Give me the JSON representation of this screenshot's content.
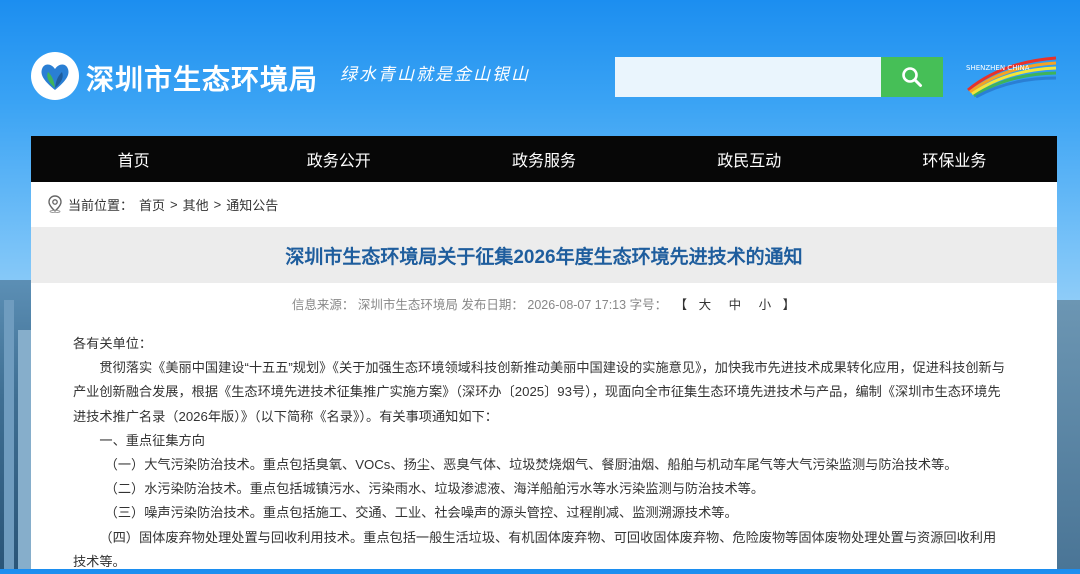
{
  "header": {
    "site_title": "深圳市生态环境局",
    "slogan": "绿水青山就是金山银山",
    "search": {
      "placeholder": ""
    },
    "city_logo_text": "SHENZHEN CHINA"
  },
  "nav": {
    "items": [
      "首页",
      "政务公开",
      "政务服务",
      "政民互动",
      "环保业务"
    ]
  },
  "breadcrumb": {
    "label": "当前位置：",
    "items": [
      "首页",
      "其他",
      "通知公告"
    ],
    "separator": ">"
  },
  "article": {
    "title": "深圳市生态环境局关于征集2026年度生态环境先进技术的通知",
    "meta": {
      "source_label": "信息来源：",
      "source": "深圳市生态环境局",
      "date_label": "发布日期：",
      "date": "2026-08-07 17:13",
      "size_label": "字号：",
      "size_open": "【",
      "sizes": [
        "大",
        "中",
        "小"
      ],
      "size_close": "】"
    },
    "paragraphs": [
      "各有关单位：",
      "贯彻落实《美丽中国建设“十五五”规划》《关于加强生态环境领域科技创新推动美丽中国建设的实施意见》，加快我市先进技术成果转化应用，促进科技创新与产业创新融合发展，根据《生态环境先进技术征集推广实施方案》（深环办〔2025〕93号），现面向全市征集生态环境先进技术与产品，编制《深圳市生态环境先进技术推广名录（2026年版）》（以下简称《名录》）。有关事项通知如下：",
      "一、重点征集方向",
      "（一）大气污染防治技术。重点包括臭氧、VOCs、扬尘、恶臭气体、垃圾焚烧烟气、餐厨油烟、船舶与机动车尾气等大气污染监测与防治技术等。",
      "（二）水污染防治技术。重点包括城镇污水、污染雨水、垃圾渗滤液、海洋船舶污水等水污染监测与防治技术等。",
      "（三）噪声污染防治技术。重点包括施工、交通、工业、社会噪声的源头管控、过程削减、监测溯源技术等。",
      "（四）固体废弃物处理处置与回收利用技术。重点包括一般生活垃圾、有机固体废弃物、可回收固体废弃物、危险废物等固体废物处理处置与资源回收利用技术等。"
    ]
  },
  "colors": {
    "nav_bg": "#070707",
    "title_color": "#1e5d9d",
    "search_button": "#46bf57",
    "title_band": "#ececec"
  },
  "icons": [
    "logo-icon",
    "search-icon",
    "location-pin-icon",
    "city-logo-icon"
  ]
}
